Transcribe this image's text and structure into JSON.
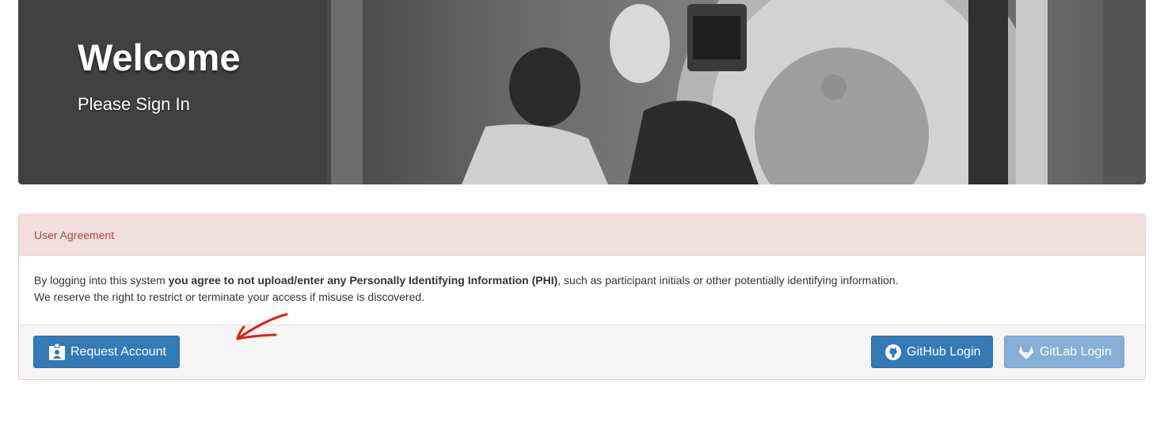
{
  "hero": {
    "title": "Welcome",
    "subtitle": "Please Sign In"
  },
  "agreement": {
    "heading": "User Agreement",
    "text_before": "By logging into this system ",
    "text_bold": "you agree to not upload/enter any Personally Identifying Information (PHI)",
    "text_after": ", such as participant initials or other potentially identifying information.",
    "text_line2": "We reserve the right to restrict or terminate your access if misuse is discovered."
  },
  "buttons": {
    "request_account": "Request Account",
    "github_login": "GitHub Login",
    "gitlab_login": "GitLab Login"
  },
  "icons": {
    "request_account": "id-badge-icon",
    "github": "github-icon",
    "gitlab": "gitlab-icon",
    "annotation": "red-arrow-annotation"
  },
  "colors": {
    "primary": "#337ab7",
    "disabled": "#86aed6",
    "danger_heading_bg": "#f2dede",
    "danger_text": "#a94442",
    "annotation": "#e0201c"
  }
}
